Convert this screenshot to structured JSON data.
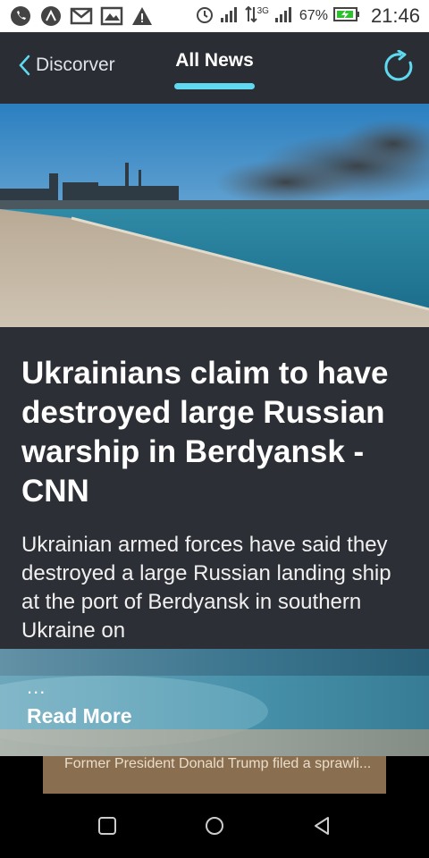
{
  "status_bar": {
    "network": "3G",
    "battery": "67%",
    "time": "21:46"
  },
  "header": {
    "back_label": "Discorver",
    "tab_label": "All News"
  },
  "article": {
    "title": "Ukrainians claim to have destroyed large Russian warship in Berdyansk - CNN",
    "summary": "Ukrainian armed forces have said they destroyed a large Russian landing ship at the port of Berdyansk in southern Ukraine on",
    "ellipsis": "...",
    "read_more": "Read More"
  },
  "next_card": {
    "text": "Former President Donald Trump filed a sprawli..."
  },
  "colors": {
    "header_bg": "#2a2d33",
    "article_bg": "#2d2f36",
    "accent": "#5fd9f0"
  }
}
